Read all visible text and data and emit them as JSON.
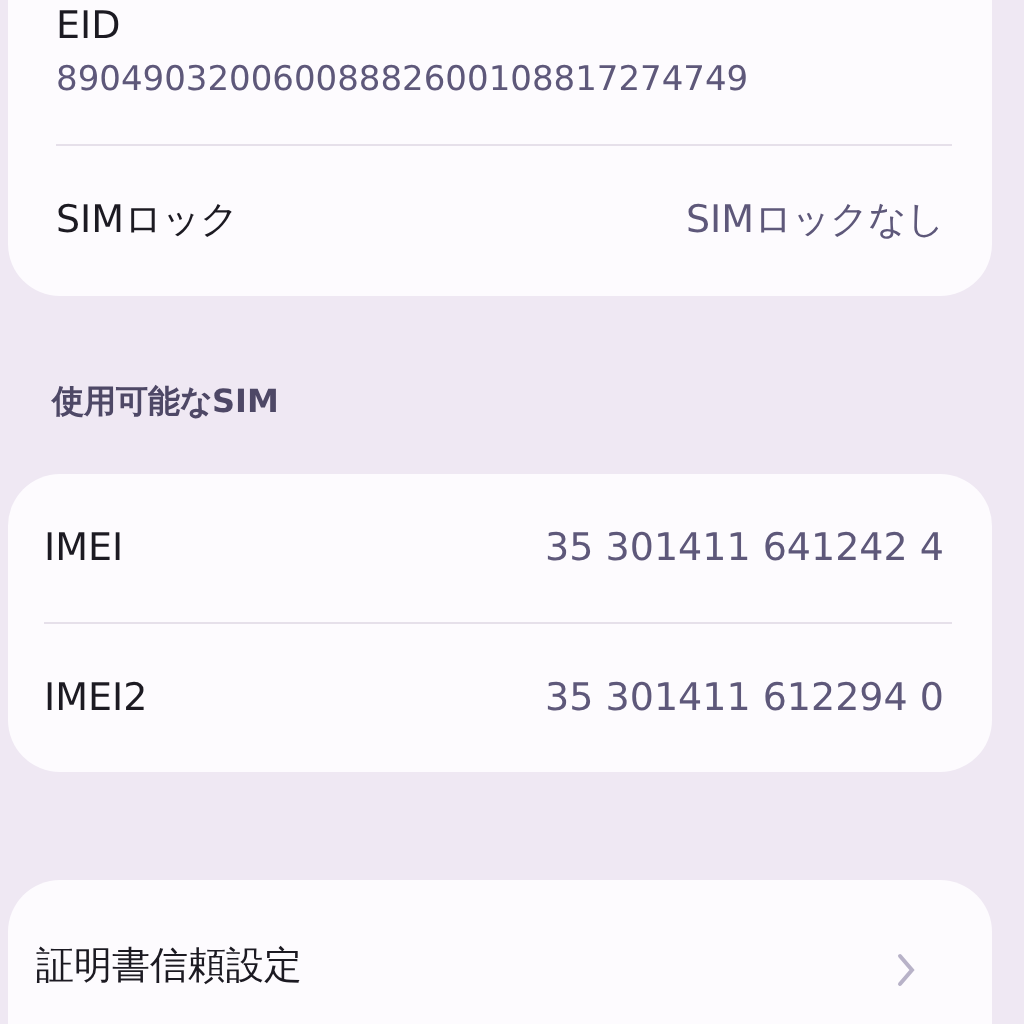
{
  "sim_card": {
    "eid": {
      "label": "EID",
      "value": "89049032006008882600108817274749"
    },
    "sim_lock": {
      "label": "SIMロック",
      "value": "SIMロックなし"
    }
  },
  "available_sim": {
    "header": "使用可能なSIM",
    "rows": [
      {
        "label": "IMEI",
        "value": "35 301411 641242 4"
      },
      {
        "label": "IMEI2",
        "value": "35 301411 612294 0"
      }
    ]
  },
  "certificate_trust": {
    "label": "証明書信頼設定"
  }
}
